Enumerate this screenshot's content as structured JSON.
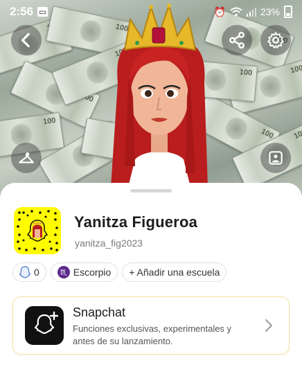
{
  "status_bar": {
    "time": "2:56",
    "battery": "23%"
  },
  "profile": {
    "display_name": "Yanitza Figueroa",
    "username": "yanitza_fig2023"
  },
  "chips": {
    "friends_count": "0",
    "zodiac": "Escorpio",
    "add_school": "+ Añadir una escuela"
  },
  "promo_card": {
    "title": "Snapchat",
    "description": "Funciones exclusivas, experimentales y antes de su lanzamiento."
  },
  "icons": {
    "back": "back-arrow-icon",
    "share": "share-icon",
    "settings": "gear-icon",
    "outfit": "hanger-icon",
    "background": "image-frame-icon"
  },
  "colors": {
    "snap_yellow": "#fffc00",
    "zodiac_purple": "#5b2a8c",
    "card_border": "#f3e2a0"
  }
}
